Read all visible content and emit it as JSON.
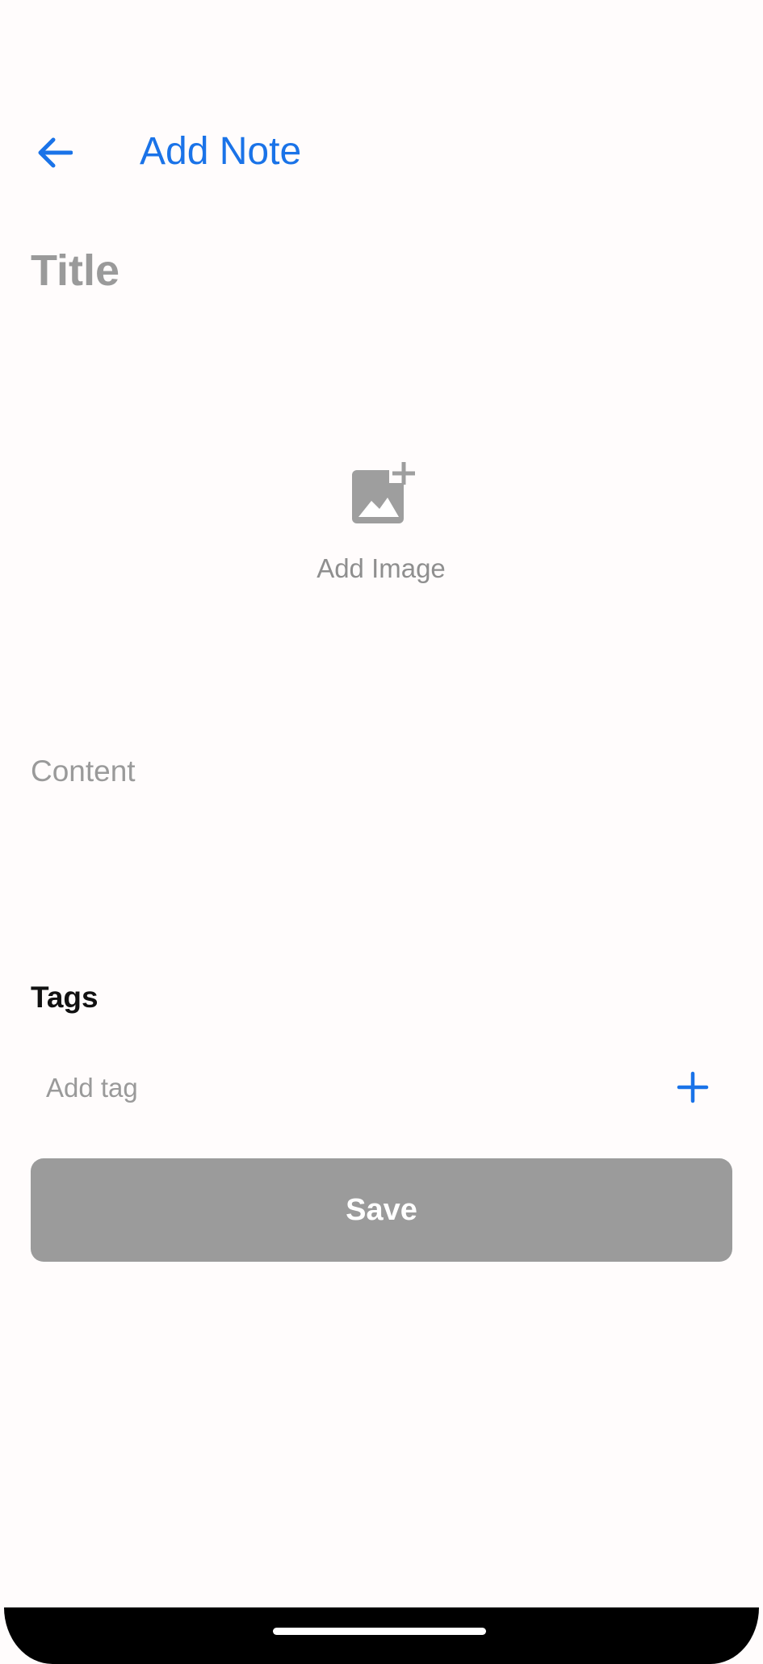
{
  "header": {
    "title": "Add Note",
    "back_icon": "arrow-back-icon"
  },
  "form": {
    "title_placeholder": "Title",
    "title_value": "",
    "add_image_label": "Add Image",
    "add_image_icon": "add-photo-icon",
    "content_placeholder": "Content",
    "content_value": "",
    "tags_heading": "Tags",
    "tag_placeholder": "Add tag",
    "tag_value": "",
    "add_tag_icon": "plus-icon",
    "save_label": "Save"
  },
  "colors": {
    "accent": "#1a73e8",
    "placeholder": "#9a9a9a",
    "disabled_button": "#9b9b9b",
    "background": "#fffcfc"
  }
}
